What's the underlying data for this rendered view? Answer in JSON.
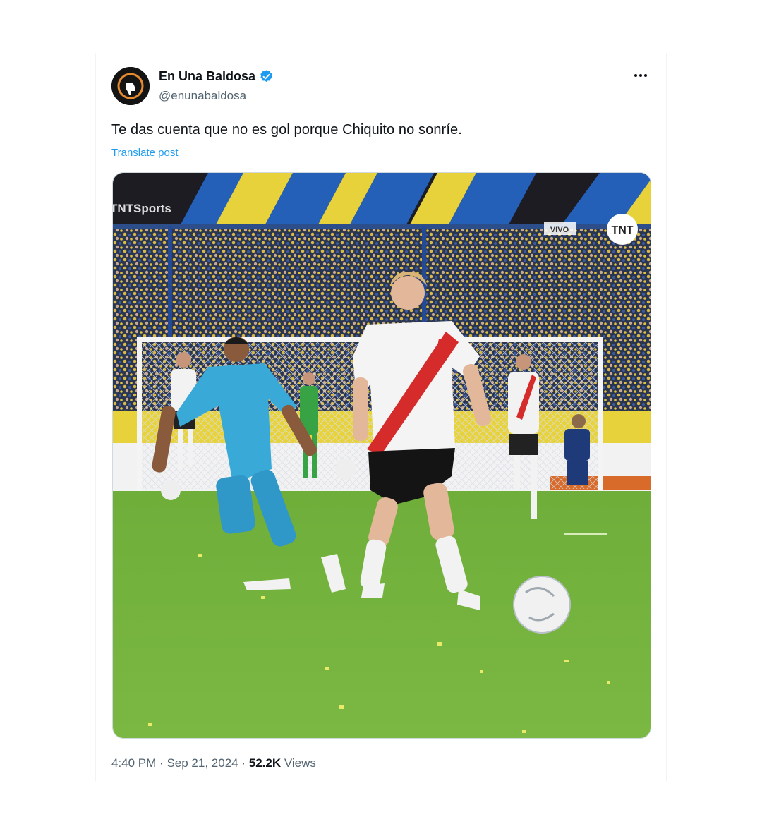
{
  "author": {
    "display_name": "En Una Baldosa",
    "handle": "@enunabaldosa",
    "verified_icon": "verified-badge-icon",
    "avatar_icon": "thumbs-down-logo-icon"
  },
  "post": {
    "text": "Te das cuenta que no es gol porque Chiquito no sonríe.",
    "translate_label": "Translate post"
  },
  "media": {
    "broadcaster_watermark": "TNTSports",
    "live_badge": "VIVO",
    "channel_logo": "TNT"
  },
  "meta": {
    "time": "4:40 PM",
    "separator": "·",
    "date": "Sep 21, 2024",
    "views_count": "52.2K",
    "views_label": "Views"
  },
  "colors": {
    "link": "#1d9bf0",
    "verified": "#1d9bf0",
    "secondary_text": "#536471",
    "primary_text": "#0f1419"
  }
}
